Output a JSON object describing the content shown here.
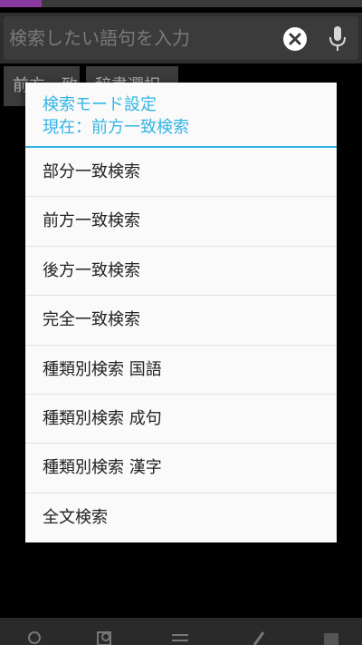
{
  "search": {
    "placeholder": "検索したい語句を入力",
    "clear_icon": "clear-circle-icon",
    "mic_icon": "microphone-icon"
  },
  "chips": [
    {
      "label": "前方一致"
    },
    {
      "label": "辞書選択"
    }
  ],
  "dialog": {
    "title": "検索モード設定",
    "subtitle": "現在：前方一致検索",
    "accent_color": "#33b5e5",
    "items": [
      {
        "label": "部分一致検索"
      },
      {
        "label": "前方一致検索"
      },
      {
        "label": "後方一致検索"
      },
      {
        "label": "完全一致検索"
      },
      {
        "label": "種類別検索 国語"
      },
      {
        "label": "種類別検索 成句"
      },
      {
        "label": "種類別検索 漢字"
      },
      {
        "label": "全文検索"
      }
    ]
  },
  "bottom_bar": {
    "icons": [
      "search-icon",
      "book-search-icon",
      "list-icon",
      "pen-icon",
      "bookmark-icon"
    ]
  }
}
